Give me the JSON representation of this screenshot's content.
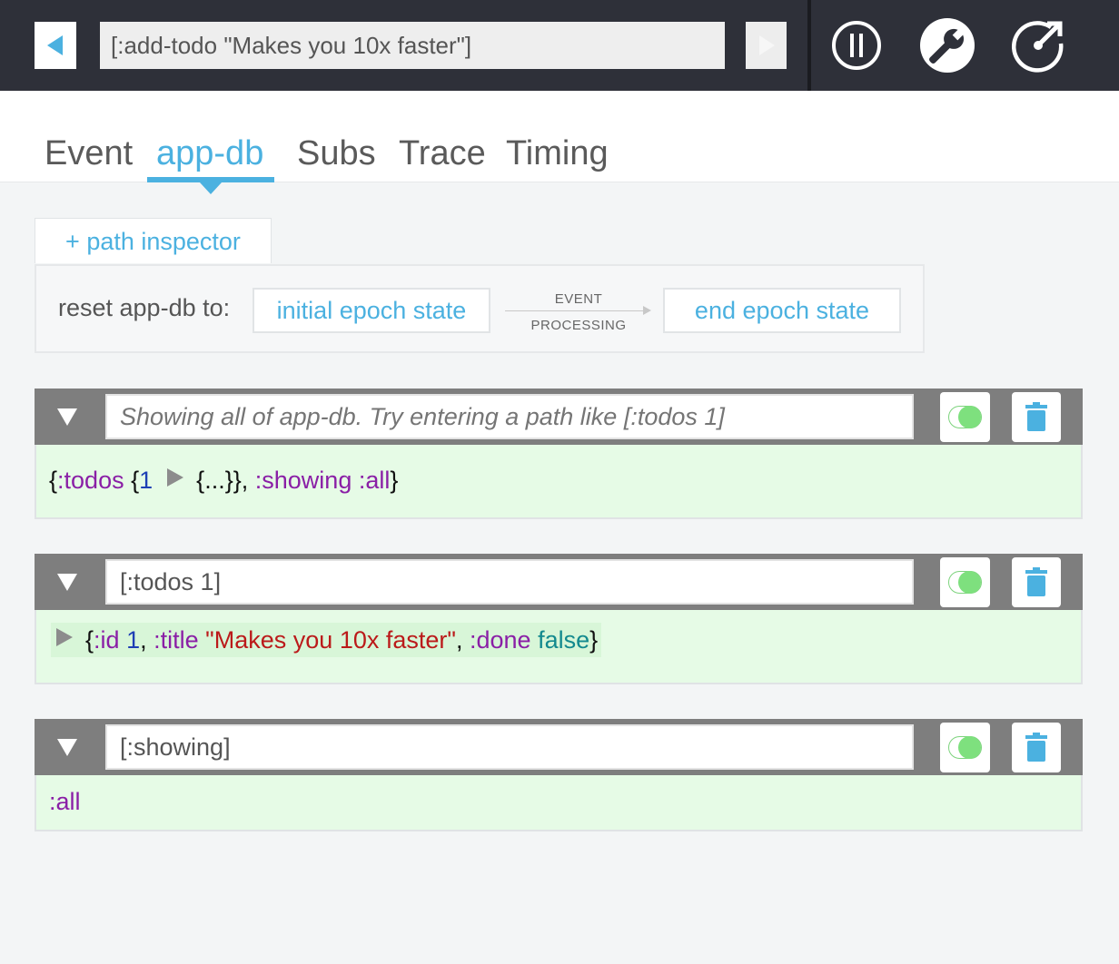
{
  "toolbar": {
    "event_text": "[:add-todo \"Makes you 10x faster\"]",
    "prev_icon": "triangle-left-icon",
    "next_icon": "triangle-right-icon",
    "pause_icon": "pause-circle-icon",
    "settings_icon": "wrench-icon",
    "popout_icon": "popout-icon"
  },
  "tabs": [
    {
      "label": "Event",
      "active": false
    },
    {
      "label": "app-db",
      "active": true
    },
    {
      "label": "Subs",
      "active": false
    },
    {
      "label": "Trace",
      "active": false
    },
    {
      "label": "Timing",
      "active": false
    }
  ],
  "path_inspector_button": "+ path inspector",
  "reset": {
    "label": "reset app-db to:",
    "initial": "initial epoch state",
    "event_line1": "EVENT",
    "event_line2": "PROCESSING",
    "end": "end epoch state"
  },
  "panels": [
    {
      "path_value": "",
      "placeholder": "Showing all of app-db. Try entering a path like [:todos 1]",
      "tokens": {
        "open": "{",
        "k1": ":todos",
        "sp1": " ",
        "open2": "{",
        "n1": "1",
        "collapsed": "{...}",
        "close": "},",
        "sp2": " ",
        "k2": ":showing",
        "sp3": " ",
        "k3": ":all",
        "close2": "}"
      }
    },
    {
      "path_value": "[:todos 1]",
      "tokens": {
        "open": "{",
        "k1": ":id",
        "sp1": " ",
        "n1": "1",
        "c1": ", ",
        "k2": ":title",
        "sp2": " ",
        "s1": "\"Makes you 10x faster\"",
        "c2": ", ",
        "k3": ":done",
        "sp3": " ",
        "b1": "false",
        "close": "}"
      }
    },
    {
      "path_value": "[:showing]",
      "tokens": {
        "k1": ":all"
      }
    }
  ],
  "colors": {
    "accent": "#4bb1e0",
    "topbar": "#2e3039",
    "panel_header": "#7e7e7e",
    "panel_body": "#e6fbe6",
    "keyword": "#8a1fa6",
    "number": "#1e3fb5",
    "string": "#bb1a1a",
    "boolean": "#13898e",
    "toggle_on": "#7ee07e",
    "trash": "#4bb1e0"
  }
}
